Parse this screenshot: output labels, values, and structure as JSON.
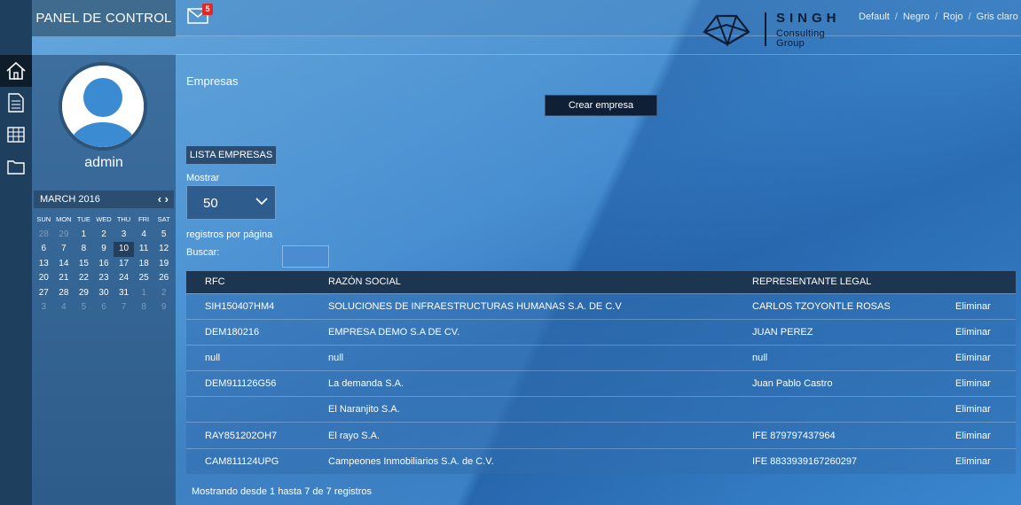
{
  "header": {
    "title": "PANEL DE CONTROL",
    "mail_count": "5",
    "brand": {
      "name": "SINGH",
      "sub1": "Consulting",
      "sub2": "Group"
    },
    "themes": [
      "Default",
      "Negro",
      "Rojo",
      "Gris claro"
    ]
  },
  "sidebar": {
    "username": "admin",
    "calendar": {
      "month": "MARCH 2016",
      "days_of_week": [
        "SUN",
        "MON",
        "TUE",
        "WED",
        "THU",
        "FRI",
        "SAT"
      ],
      "weeks": [
        [
          "28",
          "29",
          "1",
          "2",
          "3",
          "4",
          "5"
        ],
        [
          "6",
          "7",
          "8",
          "9",
          "10",
          "11",
          "12"
        ],
        [
          "13",
          "14",
          "15",
          "16",
          "17",
          "18",
          "19"
        ],
        [
          "20",
          "21",
          "22",
          "23",
          "24",
          "25",
          "26"
        ],
        [
          "27",
          "28",
          "29",
          "30",
          "31",
          "1",
          "2"
        ],
        [
          "3",
          "4",
          "5",
          "6",
          "7",
          "8",
          "9"
        ]
      ],
      "today": "10"
    }
  },
  "main": {
    "section_title": "Empresas",
    "create_button": "Crear empresa",
    "list_tab": "LISTA EMPRESAS",
    "show_label": "Mostrar",
    "page_size": "50",
    "per_page_label": "registros por página",
    "search_label": "Buscar:",
    "search_value": "",
    "table": {
      "headers": [
        "RFC",
        "RAZÓN SOCIAL",
        "REPRESENTANTE LEGAL",
        ""
      ],
      "rows": [
        [
          "SIH150407HM4",
          "SOLUCIONES DE INFRAESTRUCTURAS HUMANAS S.A. DE C.V",
          "CARLOS TZOYONTLE ROSAS",
          "Eliminar"
        ],
        [
          "DEM180216",
          "EMPRESA DEMO S.A DE CV.",
          "JUAN PEREZ",
          "Eliminar"
        ],
        [
          "null",
          "null",
          "null",
          "Eliminar"
        ],
        [
          "DEM911126G56",
          "La demanda S.A.",
          "Juan Pablo Castro",
          "Eliminar"
        ],
        [
          "",
          "El Naranjito S.A.",
          "",
          "Eliminar"
        ],
        [
          "RAY851202OH7",
          "El rayo S.A.",
          "IFE 879797437964",
          "Eliminar"
        ],
        [
          "CAM811124UPG",
          "Campeones Inmobiliarios S.A. de C.V.",
          "IFE 8833939167260297",
          "Eliminar"
        ]
      ]
    },
    "footer_info": "Mostrando desde 1 hasta 7 de 7 registros"
  }
}
